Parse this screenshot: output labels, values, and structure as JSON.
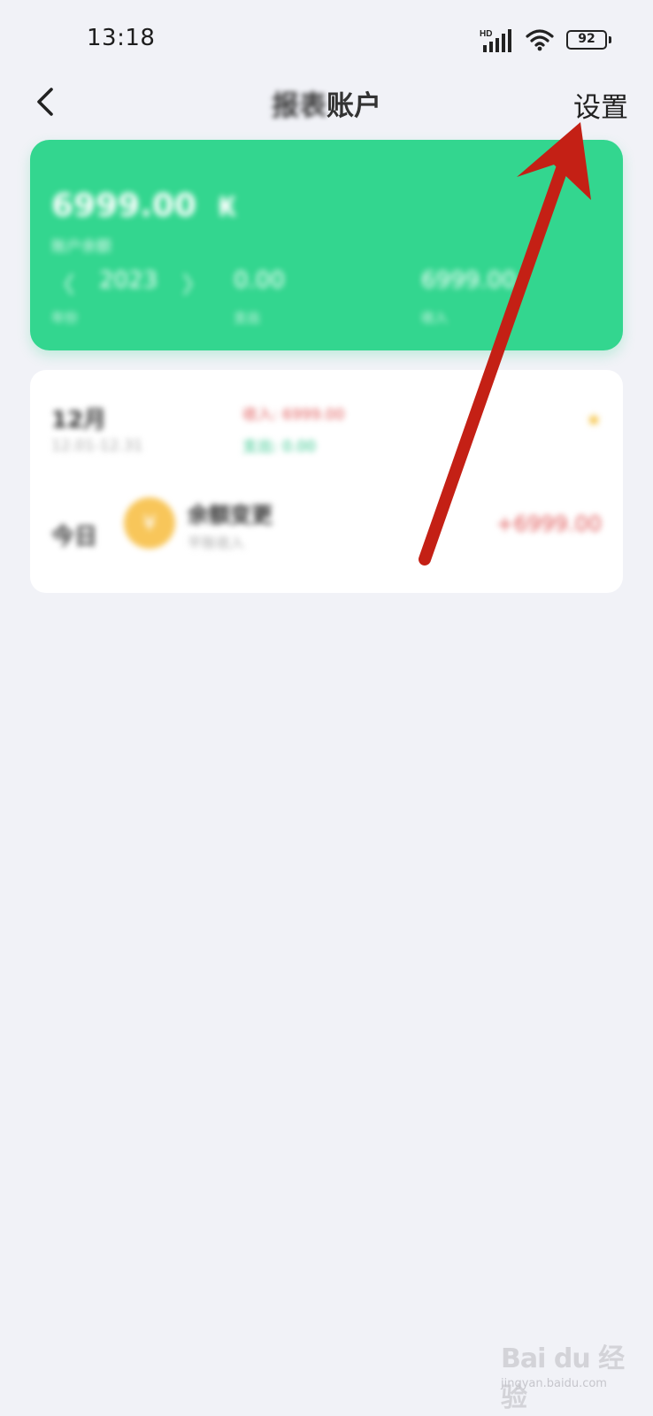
{
  "status_bar": {
    "time": "13:18",
    "network_label": "HD",
    "battery": "92"
  },
  "nav": {
    "title_blurred": "报表",
    "title_clear": "账户",
    "settings_label": "设置"
  },
  "account_card": {
    "balance": "6999.00",
    "balance_unit": "₭",
    "balance_caption": "账户余额",
    "year": "2023",
    "year_prev": "〈",
    "year_next": "〉",
    "year_caption": "年份",
    "expense_value": "0.00",
    "expense_caption": "支出",
    "income_value": "6999.00",
    "income_caption": "收入",
    "color": "#33d68f"
  },
  "month_card": {
    "month": "12月",
    "range": "12.01-12.31",
    "income": "收入: 6999.00",
    "expense": "支出: 0.00",
    "star_icon": "★",
    "transaction": {
      "day": "今日",
      "icon_glyph": "¥",
      "title": "余额变更",
      "subtitle": "平账收入",
      "amount": "+6999.00"
    }
  },
  "annotation": {
    "arrow_color": "#c42015"
  },
  "watermark": {
    "main": "Bai du 经验",
    "sub": "jingyan.baidu.com"
  }
}
